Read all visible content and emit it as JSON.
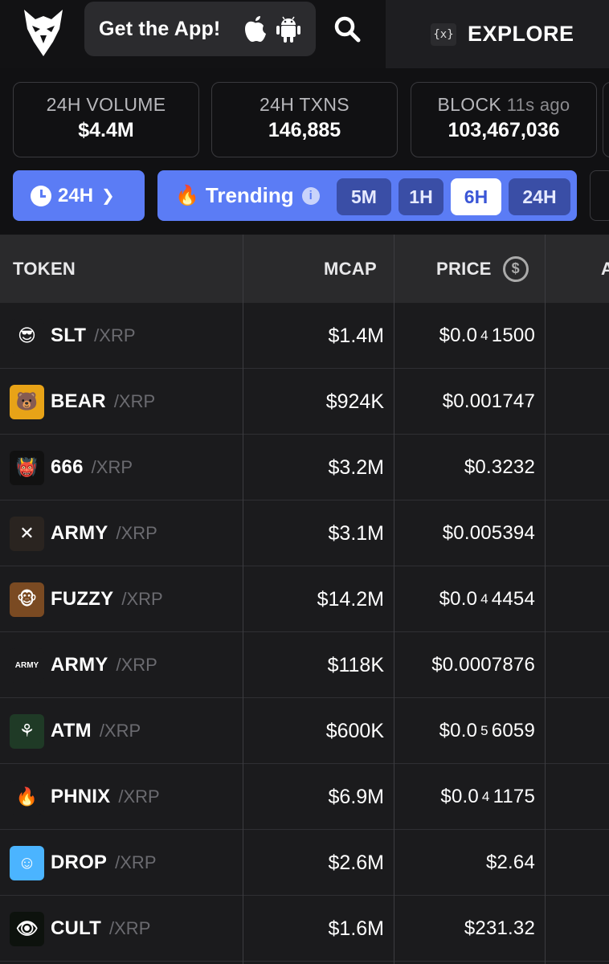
{
  "header": {
    "logo": "owl-logo",
    "get_app_label": "Get the App!",
    "explore_icon": "{x}",
    "explore_label": "EXPLORE"
  },
  "stats": [
    {
      "label": "24H VOLUME",
      "label_suffix": "",
      "value": "$4.4M"
    },
    {
      "label": "24H TXNS",
      "label_suffix": "",
      "value": "146,885"
    },
    {
      "label": "BLOCK",
      "label_suffix": "11s ago",
      "value": "103,467,036"
    }
  ],
  "filters": {
    "timeframe_label": "24H",
    "trending_label": "Trending",
    "info_glyph": "i",
    "segments": [
      "5M",
      "1H",
      "6H",
      "24H"
    ],
    "active_segment": "6H"
  },
  "table": {
    "headers": {
      "token": "TOKEN",
      "mcap": "MCAP",
      "price": "PRICE",
      "next": "A"
    },
    "rows": [
      {
        "symbol": "SLT",
        "pair": "/XRP",
        "mcap": "$1.4M",
        "price_main": "$0.0",
        "price_sub": "4",
        "price_rest": "1500",
        "ava_bg": "#1b1b1d",
        "ava_glyph": "😎"
      },
      {
        "symbol": "BEAR",
        "pair": "/XRP",
        "mcap": "$924K",
        "price_main": "$0.001747",
        "price_sub": "",
        "price_rest": "",
        "ava_bg": "#e8a317",
        "ava_glyph": "🐻"
      },
      {
        "symbol": "666",
        "pair": "/XRP",
        "mcap": "$3.2M",
        "price_main": "$0.3232",
        "price_sub": "",
        "price_rest": "",
        "ava_bg": "#111",
        "ava_glyph": "👹"
      },
      {
        "symbol": "ARMY",
        "pair": "/XRP",
        "mcap": "$3.1M",
        "price_main": "$0.005394",
        "price_sub": "",
        "price_rest": "",
        "ava_bg": "#2a2420",
        "ava_glyph": "✕"
      },
      {
        "symbol": "FUZZY",
        "pair": "/XRP",
        "mcap": "$14.2M",
        "price_main": "$0.0",
        "price_sub": "4",
        "price_rest": "4454",
        "ava_bg": "#7a4a22",
        "ava_glyph": "🐵"
      },
      {
        "symbol": "ARMY",
        "pair": "/XRP",
        "mcap": "$118K",
        "price_main": "$0.0007876",
        "price_sub": "",
        "price_rest": "",
        "ava_bg": "#1b1b1d",
        "ava_glyph": "ARMY"
      },
      {
        "symbol": "ATM",
        "pair": "/XRP",
        "mcap": "$600K",
        "price_main": "$0.0",
        "price_sub": "5",
        "price_rest": "6059",
        "ava_bg": "#1f3a26",
        "ava_glyph": "⚘"
      },
      {
        "symbol": "PHNIX",
        "pair": "/XRP",
        "mcap": "$6.9M",
        "price_main": "$0.0",
        "price_sub": "4",
        "price_rest": "1175",
        "ava_bg": "#1b1b1d",
        "ava_glyph": "🔥"
      },
      {
        "symbol": "DROP",
        "pair": "/XRP",
        "mcap": "$2.6M",
        "price_main": "$2.64",
        "price_sub": "",
        "price_rest": "",
        "ava_bg": "#4bb4ff",
        "ava_glyph": "☺"
      },
      {
        "symbol": "CULT",
        "pair": "/XRP",
        "mcap": "$1.6M",
        "price_main": "$231.32",
        "price_sub": "",
        "price_rest": "",
        "ava_bg": "#0d120d",
        "ava_glyph": "👁"
      }
    ]
  },
  "colors": {
    "accent": "#5b7cf5",
    "bg": "#1a1a1c"
  }
}
